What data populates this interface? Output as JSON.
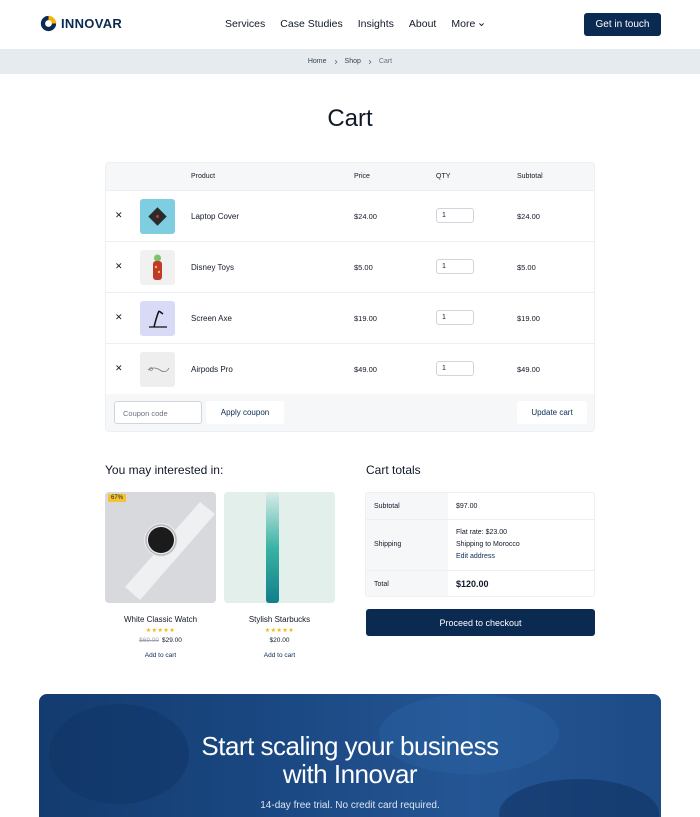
{
  "brand": {
    "name": "INNOVAR"
  },
  "nav": {
    "items": [
      "Services",
      "Case Studies",
      "Insights",
      "About",
      "More"
    ],
    "cta": "Get in touch"
  },
  "breadcrumb": {
    "items": [
      "Home",
      "Shop",
      "Cart"
    ]
  },
  "page": {
    "title": "Cart"
  },
  "cart": {
    "columns": [
      "Product",
      "Price",
      "QTY",
      "Subtotal"
    ],
    "rows": [
      {
        "name": "Laptop Cover",
        "price": "$24.00",
        "qty": "1",
        "subtotal": "$24.00"
      },
      {
        "name": "Disney Toys",
        "price": "$5.00",
        "qty": "1",
        "subtotal": "$5.00"
      },
      {
        "name": "Screen Axe",
        "price": "$19.00",
        "qty": "1",
        "subtotal": "$19.00"
      },
      {
        "name": "Airpods Pro",
        "price": "$49.00",
        "qty": "1",
        "subtotal": "$49.00"
      }
    ],
    "coupon_placeholder": "Coupon code",
    "apply_label": "Apply coupon",
    "update_label": "Update cart"
  },
  "recommend": {
    "title": "You may interested in:",
    "products": [
      {
        "name": "White Classic Watch",
        "badge": "67%",
        "stars": "★★★★★",
        "old_price": "$69.00",
        "price": "$29.00",
        "add": "Add to cart"
      },
      {
        "name": "Stylish Starbucks",
        "badge": "",
        "stars": "★★★★★",
        "old_price": "",
        "price": "$20.00",
        "add": "Add to cart"
      }
    ]
  },
  "totals": {
    "title": "Cart totals",
    "subtotal_label": "Subtotal",
    "subtotal": "$97.00",
    "shipping_label": "Shipping",
    "shipping_rate": "Flat rate: $23.00",
    "shipping_to": "Shipping to Morocco",
    "edit_address": "Edit address",
    "total_label": "Total",
    "total": "$120.00",
    "checkout": "Proceed to checkout"
  },
  "banner": {
    "headline_1": "Start scaling your business",
    "headline_2": "with Innovar",
    "sub": "14-day free trial. No credit card required."
  },
  "colors": {
    "primary": "#0b2a52",
    "accent_star": "#f4b400",
    "badge": "#f4c430"
  },
  "icons": [
    "logo-icon",
    "chevron-down-icon",
    "chevron-right-icon",
    "close-icon"
  ]
}
